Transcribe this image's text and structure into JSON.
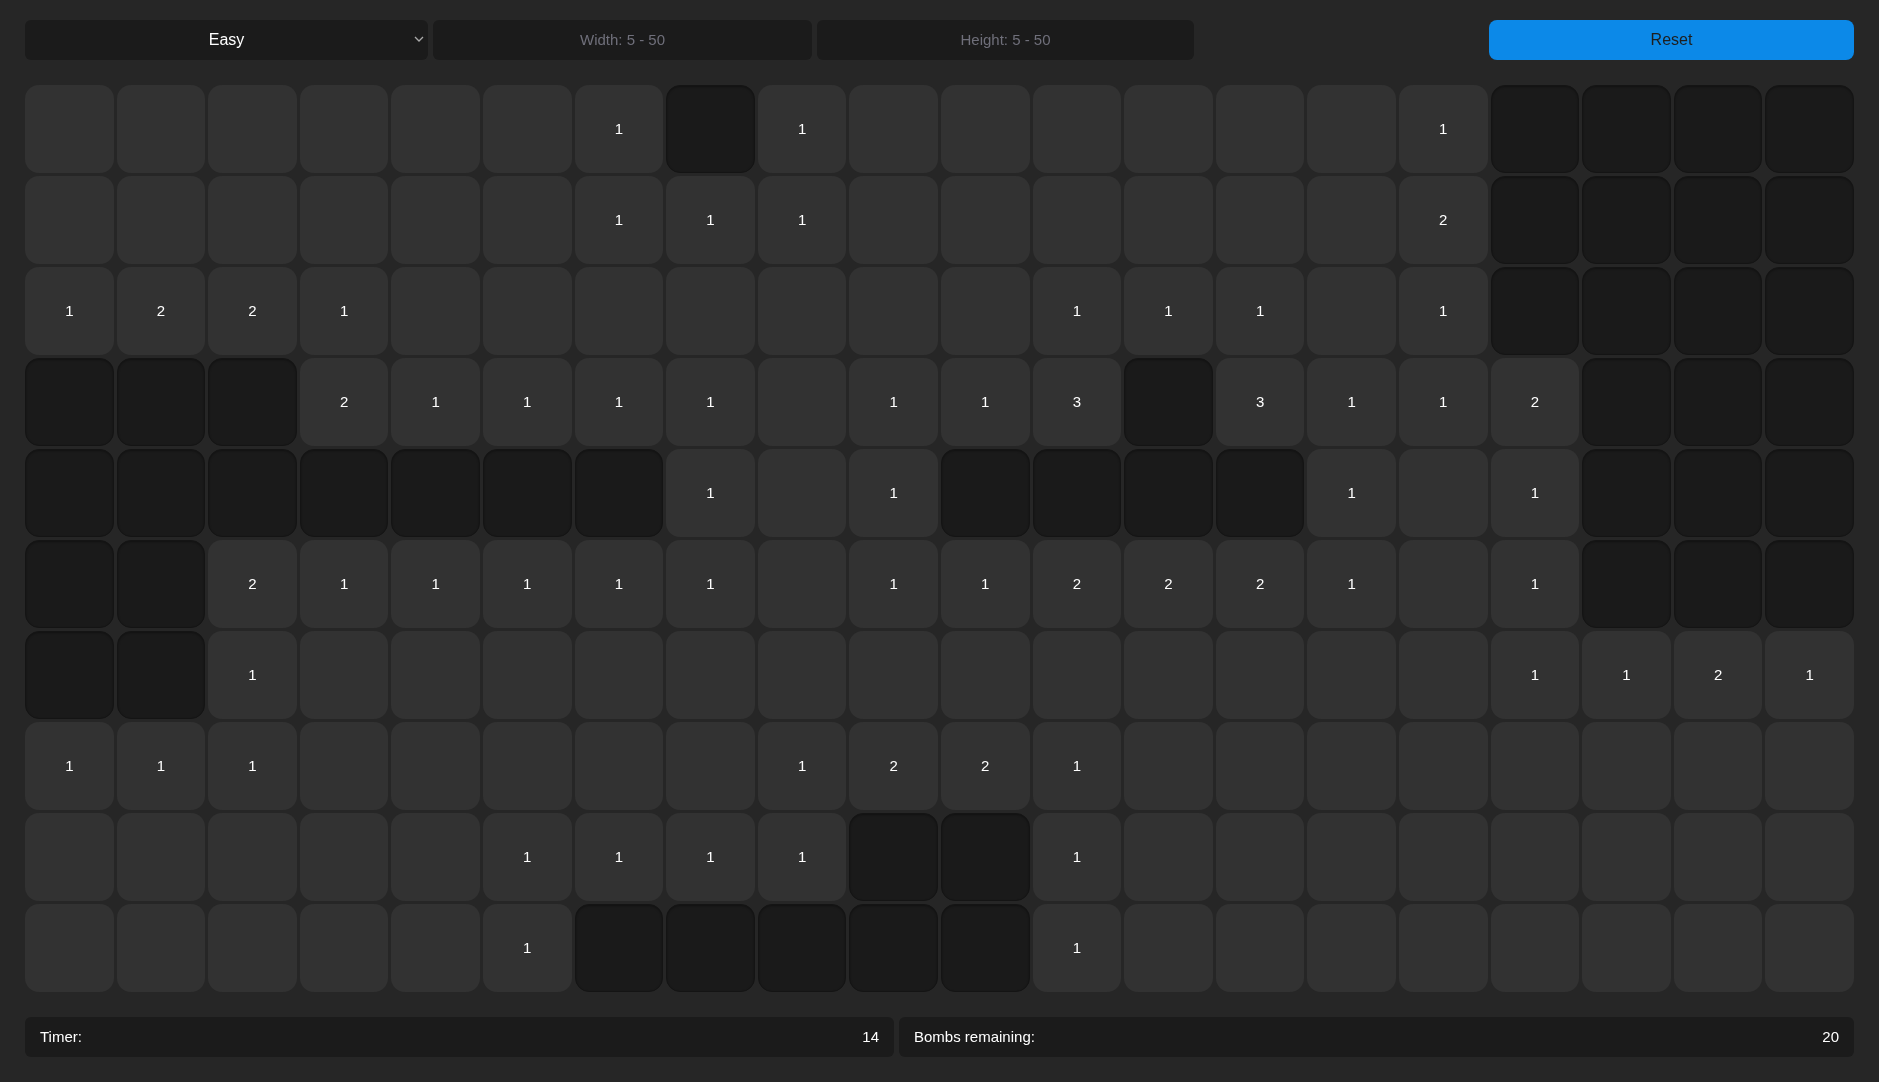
{
  "toolbar": {
    "difficulty": "Easy",
    "width_field": {
      "placeholder": "Width: 5 - 50"
    },
    "height_field": {
      "placeholder": "Height: 5 - 50"
    },
    "reset_button": "Reset"
  },
  "board": {
    "rows": [
      [
        {
          "revealed": true
        },
        {
          "revealed": true
        },
        {
          "revealed": true
        },
        {
          "revealed": true
        },
        {
          "revealed": true
        },
        {
          "revealed": true
        },
        {
          "revealed": true,
          "number": "1"
        },
        {
          "revealed": false
        },
        {
          "revealed": true,
          "number": "1"
        },
        {
          "revealed": true
        },
        {
          "revealed": true
        },
        {
          "revealed": true
        },
        {
          "revealed": true
        },
        {
          "revealed": true
        },
        {
          "revealed": true
        },
        {
          "revealed": true,
          "number": "1"
        },
        {
          "revealed": false
        },
        {
          "revealed": false
        },
        {
          "revealed": false
        },
        {
          "revealed": false
        }
      ],
      [
        {
          "revealed": true
        },
        {
          "revealed": true
        },
        {
          "revealed": true
        },
        {
          "revealed": true
        },
        {
          "revealed": true
        },
        {
          "revealed": true
        },
        {
          "revealed": true,
          "number": "1"
        },
        {
          "revealed": true,
          "number": "1"
        },
        {
          "revealed": true,
          "number": "1"
        },
        {
          "revealed": true
        },
        {
          "revealed": true
        },
        {
          "revealed": true
        },
        {
          "revealed": true
        },
        {
          "revealed": true
        },
        {
          "revealed": true
        },
        {
          "revealed": true,
          "number": "2"
        },
        {
          "revealed": false
        },
        {
          "revealed": false
        },
        {
          "revealed": false
        },
        {
          "revealed": false
        }
      ],
      [
        {
          "revealed": true,
          "number": "1"
        },
        {
          "revealed": true,
          "number": "2"
        },
        {
          "revealed": true,
          "number": "2"
        },
        {
          "revealed": true,
          "number": "1"
        },
        {
          "revealed": true
        },
        {
          "revealed": true
        },
        {
          "revealed": true
        },
        {
          "revealed": true
        },
        {
          "revealed": true
        },
        {
          "revealed": true
        },
        {
          "revealed": true
        },
        {
          "revealed": true,
          "number": "1"
        },
        {
          "revealed": true,
          "number": "1"
        },
        {
          "revealed": true,
          "number": "1"
        },
        {
          "revealed": true
        },
        {
          "revealed": true,
          "number": "1"
        },
        {
          "revealed": false
        },
        {
          "revealed": false
        },
        {
          "revealed": false
        },
        {
          "revealed": false
        }
      ],
      [
        {
          "revealed": false
        },
        {
          "revealed": false
        },
        {
          "revealed": false
        },
        {
          "revealed": true,
          "number": "2"
        },
        {
          "revealed": true,
          "number": "1"
        },
        {
          "revealed": true,
          "number": "1"
        },
        {
          "revealed": true,
          "number": "1"
        },
        {
          "revealed": true,
          "number": "1"
        },
        {
          "revealed": true
        },
        {
          "revealed": true,
          "number": "1"
        },
        {
          "revealed": true,
          "number": "1"
        },
        {
          "revealed": true,
          "number": "3"
        },
        {
          "revealed": false
        },
        {
          "revealed": true,
          "number": "3"
        },
        {
          "revealed": true,
          "number": "1"
        },
        {
          "revealed": true,
          "number": "1"
        },
        {
          "revealed": true,
          "number": "2"
        },
        {
          "revealed": false
        },
        {
          "revealed": false
        },
        {
          "revealed": false
        }
      ],
      [
        {
          "revealed": false
        },
        {
          "revealed": false
        },
        {
          "revealed": false
        },
        {
          "revealed": false
        },
        {
          "revealed": false
        },
        {
          "revealed": false
        },
        {
          "revealed": false
        },
        {
          "revealed": true,
          "number": "1"
        },
        {
          "revealed": true
        },
        {
          "revealed": true,
          "number": "1"
        },
        {
          "revealed": false
        },
        {
          "revealed": false
        },
        {
          "revealed": false
        },
        {
          "revealed": false
        },
        {
          "revealed": true,
          "number": "1"
        },
        {
          "revealed": true
        },
        {
          "revealed": true,
          "number": "1"
        },
        {
          "revealed": false
        },
        {
          "revealed": false
        },
        {
          "revealed": false
        }
      ],
      [
        {
          "revealed": false
        },
        {
          "revealed": false
        },
        {
          "revealed": true,
          "number": "2"
        },
        {
          "revealed": true,
          "number": "1"
        },
        {
          "revealed": true,
          "number": "1"
        },
        {
          "revealed": true,
          "number": "1"
        },
        {
          "revealed": true,
          "number": "1"
        },
        {
          "revealed": true,
          "number": "1"
        },
        {
          "revealed": true
        },
        {
          "revealed": true,
          "number": "1"
        },
        {
          "revealed": true,
          "number": "1"
        },
        {
          "revealed": true,
          "number": "2"
        },
        {
          "revealed": true,
          "number": "2"
        },
        {
          "revealed": true,
          "number": "2"
        },
        {
          "revealed": true,
          "number": "1"
        },
        {
          "revealed": true
        },
        {
          "revealed": true,
          "number": "1"
        },
        {
          "revealed": false
        },
        {
          "revealed": false
        },
        {
          "revealed": false
        }
      ],
      [
        {
          "revealed": false
        },
        {
          "revealed": false
        },
        {
          "revealed": true,
          "number": "1"
        },
        {
          "revealed": true
        },
        {
          "revealed": true
        },
        {
          "revealed": true
        },
        {
          "revealed": true
        },
        {
          "revealed": true
        },
        {
          "revealed": true
        },
        {
          "revealed": true
        },
        {
          "revealed": true
        },
        {
          "revealed": true
        },
        {
          "revealed": true
        },
        {
          "revealed": true
        },
        {
          "revealed": true
        },
        {
          "revealed": true
        },
        {
          "revealed": true,
          "number": "1"
        },
        {
          "revealed": true,
          "number": "1"
        },
        {
          "revealed": true,
          "number": "2"
        },
        {
          "revealed": true,
          "number": "1"
        }
      ],
      [
        {
          "revealed": true,
          "number": "1"
        },
        {
          "revealed": true,
          "number": "1"
        },
        {
          "revealed": true,
          "number": "1"
        },
        {
          "revealed": true
        },
        {
          "revealed": true
        },
        {
          "revealed": true
        },
        {
          "revealed": true
        },
        {
          "revealed": true
        },
        {
          "revealed": true,
          "number": "1"
        },
        {
          "revealed": true,
          "number": "2"
        },
        {
          "revealed": true,
          "number": "2"
        },
        {
          "revealed": true,
          "number": "1"
        },
        {
          "revealed": true
        },
        {
          "revealed": true
        },
        {
          "revealed": true
        },
        {
          "revealed": true
        },
        {
          "revealed": true
        },
        {
          "revealed": true
        },
        {
          "revealed": true
        },
        {
          "revealed": true
        }
      ],
      [
        {
          "revealed": true
        },
        {
          "revealed": true
        },
        {
          "revealed": true
        },
        {
          "revealed": true
        },
        {
          "revealed": true
        },
        {
          "revealed": true,
          "number": "1"
        },
        {
          "revealed": true,
          "number": "1"
        },
        {
          "revealed": true,
          "number": "1"
        },
        {
          "revealed": true,
          "number": "1"
        },
        {
          "revealed": false
        },
        {
          "revealed": false
        },
        {
          "revealed": true,
          "number": "1"
        },
        {
          "revealed": true
        },
        {
          "revealed": true
        },
        {
          "revealed": true
        },
        {
          "revealed": true
        },
        {
          "revealed": true
        },
        {
          "revealed": true
        },
        {
          "revealed": true
        },
        {
          "revealed": true
        }
      ],
      [
        {
          "revealed": true
        },
        {
          "revealed": true
        },
        {
          "revealed": true
        },
        {
          "revealed": true
        },
        {
          "revealed": true
        },
        {
          "revealed": true,
          "number": "1"
        },
        {
          "revealed": false
        },
        {
          "revealed": false
        },
        {
          "revealed": false
        },
        {
          "revealed": false
        },
        {
          "revealed": false
        },
        {
          "revealed": true,
          "number": "1"
        },
        {
          "revealed": true
        },
        {
          "revealed": true
        },
        {
          "revealed": true
        },
        {
          "revealed": true
        },
        {
          "revealed": true
        },
        {
          "revealed": true
        },
        {
          "revealed": true
        },
        {
          "revealed": true
        }
      ]
    ]
  },
  "status": {
    "timer_label": "Timer:",
    "timer_value": "14",
    "bombs_label": "Bombs remaining:",
    "bombs_value": "20"
  }
}
